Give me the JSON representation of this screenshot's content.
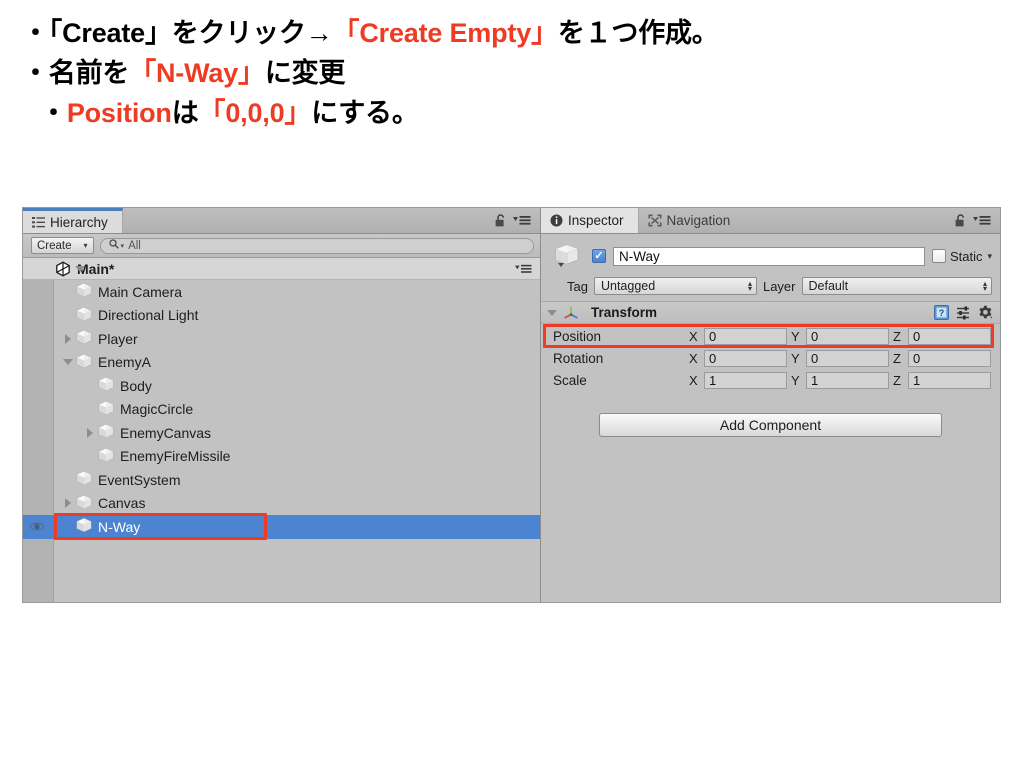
{
  "slide": {
    "lines": [
      {
        "indent": 1,
        "segments": [
          {
            "text": "・「Create」をクリック→",
            "highlight": false
          },
          {
            "text": "「Create Empty」",
            "highlight": true
          },
          {
            "text": "を１つ作成。",
            "highlight": false
          }
        ]
      },
      {
        "indent": 1,
        "segments": [
          {
            "text": "・名前を",
            "highlight": false
          },
          {
            "text": "「N-Way」",
            "highlight": true
          },
          {
            "text": "に変更",
            "highlight": false
          }
        ]
      },
      {
        "indent": 2,
        "segments": [
          {
            "text": "・",
            "highlight": false
          },
          {
            "text": "Position",
            "highlight": true
          },
          {
            "text": "は",
            "highlight": false
          },
          {
            "text": "「0,0,0」",
            "highlight": true
          },
          {
            "text": "にする。",
            "highlight": false
          }
        ]
      }
    ],
    "highlight_color": "#ee3b23"
  },
  "hierarchy": {
    "tab_label": "Hierarchy",
    "tab_icon": "hierarchy-list-icon",
    "lock_icon": "lock-icon",
    "menu_icon": "panel-menu-icon",
    "toolbar": {
      "create_label": "Create",
      "create_caret": "▾",
      "search_placeholder": "All",
      "search_value": "All",
      "search_icon": "magnifier-icon"
    },
    "scene": {
      "name": "Main*",
      "icon": "unity-logo-icon",
      "expanded": true,
      "menu_icon": "scene-menu-icon"
    },
    "items": [
      {
        "label": "Main Camera",
        "depth": 1,
        "twisty": "none",
        "selected": false,
        "eye": false
      },
      {
        "label": "Directional Light",
        "depth": 1,
        "twisty": "none",
        "selected": false,
        "eye": false
      },
      {
        "label": "Player",
        "depth": 1,
        "twisty": "collapsed",
        "selected": false,
        "eye": false
      },
      {
        "label": "EnemyA",
        "depth": 1,
        "twisty": "expanded",
        "selected": false,
        "eye": false
      },
      {
        "label": "Body",
        "depth": 2,
        "twisty": "none",
        "selected": false,
        "eye": false
      },
      {
        "label": "MagicCircle",
        "depth": 2,
        "twisty": "none",
        "selected": false,
        "eye": false
      },
      {
        "label": "EnemyCanvas",
        "depth": 2,
        "twisty": "collapsed",
        "selected": false,
        "eye": false
      },
      {
        "label": "EnemyFireMissile",
        "depth": 2,
        "twisty": "none",
        "selected": false,
        "eye": false
      },
      {
        "label": "EventSystem",
        "depth": 1,
        "twisty": "none",
        "selected": false,
        "eye": false
      },
      {
        "label": "Canvas",
        "depth": 1,
        "twisty": "collapsed",
        "selected": false,
        "eye": false
      },
      {
        "label": "N-Way",
        "depth": 1,
        "twisty": "none",
        "selected": true,
        "eye": true
      }
    ],
    "selection_color": "#4d84d1"
  },
  "inspector": {
    "tabs": [
      {
        "label": "Inspector",
        "icon": "info-icon",
        "active": true
      },
      {
        "label": "Navigation",
        "icon": "navigation-icon",
        "active": false
      }
    ],
    "lock_icon": "lock-icon",
    "menu_icon": "panel-menu-icon",
    "object": {
      "enabled": true,
      "name": "N-Way",
      "static_label": "Static",
      "static_checked": false,
      "static_caret": "▾",
      "tag_label": "Tag",
      "tag_value": "Untagged",
      "layer_label": "Layer",
      "layer_value": "Default"
    },
    "transform": {
      "title": "Transform",
      "expanded": true,
      "gizmo_icon": "transform-axis-icon",
      "help_icon": "help-book-icon",
      "preset_icon": "preset-sliders-icon",
      "gear_icon": "gear-icon",
      "rows": [
        {
          "name": "Position",
          "x": "0",
          "y": "0",
          "z": "0",
          "highlighted": true
        },
        {
          "name": "Rotation",
          "x": "0",
          "y": "0",
          "z": "0",
          "highlighted": false
        },
        {
          "name": "Scale",
          "x": "1",
          "y": "1",
          "z": "1",
          "highlighted": false
        }
      ],
      "axis_labels": {
        "x": "X",
        "y": "Y",
        "z": "Z"
      }
    },
    "add_component_label": "Add Component"
  }
}
